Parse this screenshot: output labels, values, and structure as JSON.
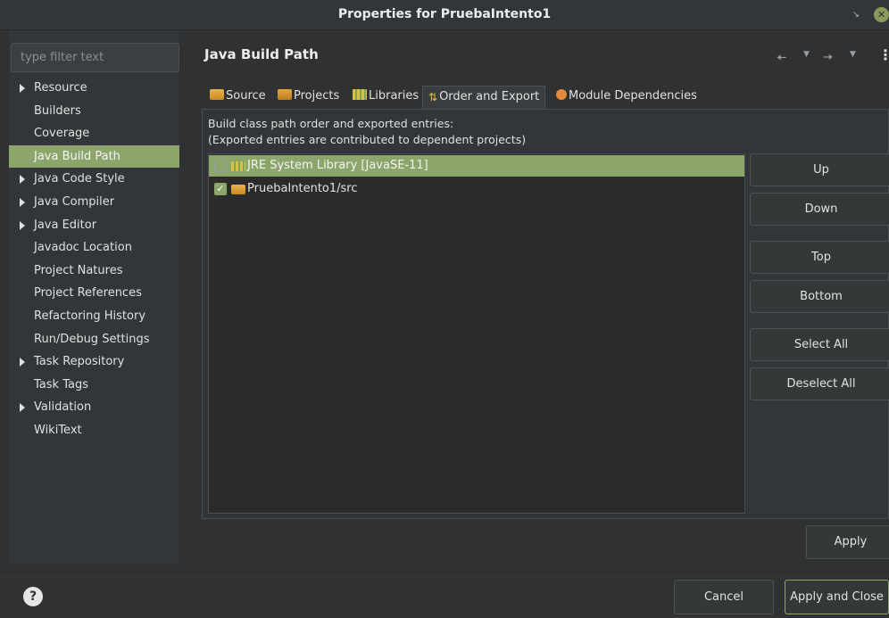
{
  "window": {
    "title": "Properties for PruebaIntento1"
  },
  "filter": {
    "placeholder": "type filter text"
  },
  "sidebar": {
    "items": [
      {
        "label": "Resource",
        "expandable": true
      },
      {
        "label": "Builders",
        "expandable": false
      },
      {
        "label": "Coverage",
        "expandable": false
      },
      {
        "label": "Java Build Path",
        "expandable": false,
        "selected": true
      },
      {
        "label": "Java Code Style",
        "expandable": true
      },
      {
        "label": "Java Compiler",
        "expandable": true
      },
      {
        "label": "Java Editor",
        "expandable": true
      },
      {
        "label": "Javadoc Location",
        "expandable": false
      },
      {
        "label": "Project Natures",
        "expandable": false
      },
      {
        "label": "Project References",
        "expandable": false
      },
      {
        "label": "Refactoring History",
        "expandable": false
      },
      {
        "label": "Run/Debug Settings",
        "expandable": false
      },
      {
        "label": "Task Repository",
        "expandable": true
      },
      {
        "label": "Task Tags",
        "expandable": false
      },
      {
        "label": "Validation",
        "expandable": true
      },
      {
        "label": "WikiText",
        "expandable": false
      }
    ]
  },
  "page": {
    "title": "Java Build Path"
  },
  "tabs": [
    {
      "label": "Source",
      "icon": "source-folder-icon"
    },
    {
      "label": "Projects",
      "icon": "project-folder-icon"
    },
    {
      "label": "Libraries",
      "icon": "library-icon"
    },
    {
      "label": "Order and Export",
      "icon": "order-export-icon",
      "active": true
    },
    {
      "label": "Module Dependencies",
      "icon": "module-icon"
    }
  ],
  "order_export": {
    "description_line1": "Build class path order and exported entries:",
    "description_line2": "(Exported entries are contributed to dependent projects)",
    "entries": [
      {
        "label": "JRE System Library [JavaSE-11]",
        "checked": false,
        "selected": true,
        "icon": "library-icon"
      },
      {
        "label": "PruebaIntento1/src",
        "checked": true,
        "selected": false,
        "icon": "source-folder-icon"
      }
    ],
    "buttons": {
      "up": "Up",
      "down": "Down",
      "top": "Top",
      "bottom": "Bottom",
      "select_all": "Select All",
      "deselect_all": "Deselect All"
    }
  },
  "apply_label": "Apply",
  "footer": {
    "cancel_label": "Cancel",
    "apply_close_label": "Apply and Close",
    "help_glyph": "?"
  },
  "colors": {
    "accent": "#8ca56b",
    "background": "#2f3133",
    "list_background": "#2b2b2b"
  }
}
